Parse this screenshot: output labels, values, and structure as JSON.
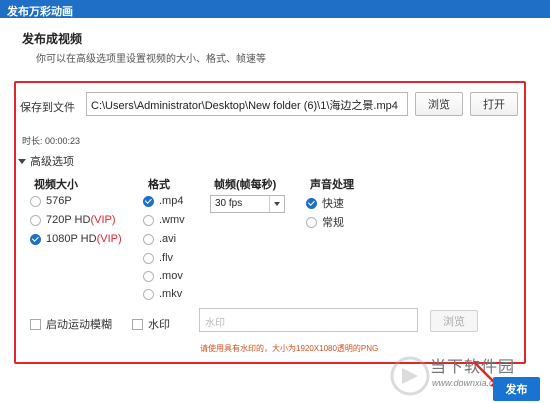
{
  "window": {
    "title": "发布万彩动画"
  },
  "header": {
    "title": "发布成视频",
    "subtitle": "你可以在高级选项里设置视频的大小、格式、帧速等"
  },
  "save": {
    "label": "保存到文件",
    "path": "C:\\Users\\Administrator\\Desktop\\New folder (6)\\1\\海边之景.mp4",
    "browse_label": "浏览",
    "open_label": "打开"
  },
  "duration": "时长: 00:00:23",
  "advanced": {
    "label": "高级选项"
  },
  "size": {
    "heading": "视频大小",
    "options": [
      {
        "label": "576P",
        "vip": "",
        "checked": false
      },
      {
        "label": "720P HD",
        "vip": "(VIP)",
        "checked": false
      },
      {
        "label": "1080P HD",
        "vip": "(VIP)",
        "checked": true
      }
    ]
  },
  "format": {
    "heading": "格式",
    "options": [
      {
        "label": ".mp4",
        "checked": true
      },
      {
        "label": ".wmv",
        "checked": false
      },
      {
        "label": ".avi",
        "checked": false
      },
      {
        "label": ".flv",
        "checked": false
      },
      {
        "label": ".mov",
        "checked": false
      },
      {
        "label": ".mkv",
        "checked": false
      }
    ]
  },
  "fps": {
    "heading": "帧频(帧每秒)",
    "value": "30 fps"
  },
  "audio": {
    "heading": "声音处理",
    "options": [
      {
        "label": "快速",
        "checked": true
      },
      {
        "label": "常规",
        "checked": false
      }
    ]
  },
  "motion_blur": {
    "label": "启动运动模糊"
  },
  "watermark": {
    "label": "水印",
    "placeholder": "水印",
    "browse_label": "浏览",
    "note": "请使用具有水印的，大小为1920X1080透明的PNG"
  },
  "publish": {
    "label": "发布"
  },
  "brand": {
    "text": "当下软件园",
    "sub": "www.downxia.com"
  },
  "colors": {
    "accent": "#1f6fc6",
    "highlight": "#e0262f",
    "note": "#d2501f"
  }
}
